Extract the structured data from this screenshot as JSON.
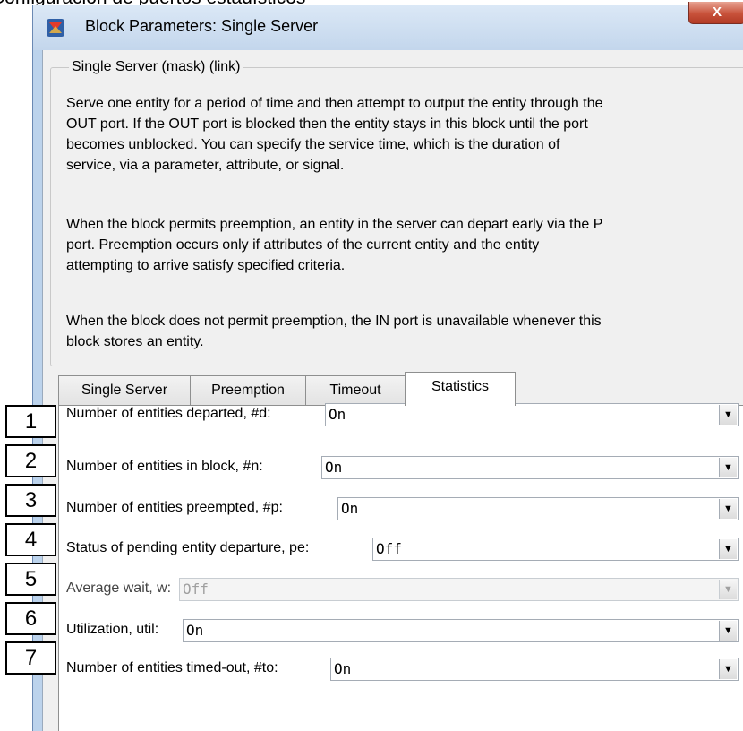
{
  "caption": "Configuración de puertos estadísticos",
  "window": {
    "title": "Block Parameters: Single Server",
    "close_label": "X"
  },
  "group": {
    "legend": "Single Server (mask) (link)",
    "paragraphs": [
      [
        "Serve one entity for a period of time and then attempt to output the entity through the",
        "OUT port. If the OUT port is blocked then the entity stays in this block until the port",
        "becomes unblocked. You can specify the service time, which is the duration of",
        "service, via a parameter, attribute, or signal."
      ],
      [
        "When the block permits preemption, an entity in the server can depart early via the P",
        "port. Preemption occurs only if attributes of the current entity and the entity",
        "attempting to arrive satisfy specified criteria."
      ],
      [
        "When the block does not permit preemption, the IN port is unavailable whenever this",
        "block stores an entity."
      ]
    ]
  },
  "tabs": [
    {
      "label": "Single Server",
      "active": false
    },
    {
      "label": "Preemption",
      "active": false
    },
    {
      "label": "Timeout",
      "active": false
    },
    {
      "label": "Statistics",
      "active": true
    }
  ],
  "parameters": [
    {
      "label": "Number of entities departed, #d:",
      "value": "On",
      "enabled": true
    },
    {
      "label": "Number of entities in block, #n:",
      "value": "On",
      "enabled": true
    },
    {
      "label": "Number of entities preempted, #p:",
      "value": "On",
      "enabled": true
    },
    {
      "label": "Status of pending entity departure, pe:",
      "value": "Off",
      "enabled": true
    },
    {
      "label": "Average wait, w:",
      "value": "Off",
      "enabled": false
    },
    {
      "label": "Utilization, util:",
      "value": "On",
      "enabled": true
    },
    {
      "label": "Number of entities timed-out, #to:",
      "value": "On",
      "enabled": true
    }
  ],
  "annotations": [
    "1",
    "2",
    "3",
    "4",
    "5",
    "6",
    "7"
  ],
  "icons": {
    "dropdown": "chevron-down-icon",
    "app": "simulink-block-icon"
  }
}
